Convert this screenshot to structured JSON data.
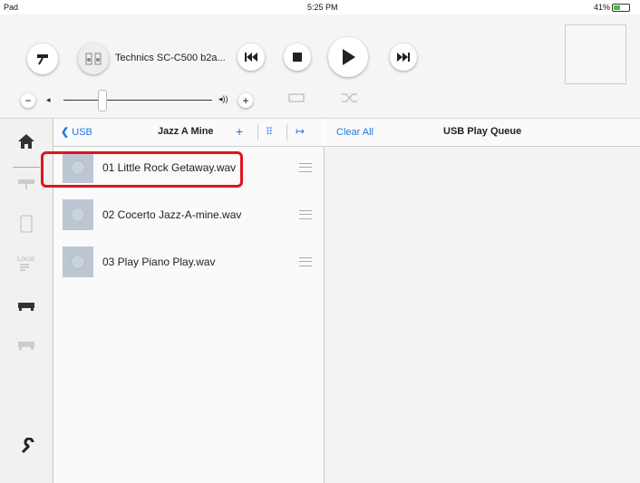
{
  "status_bar": {
    "left": "Pad",
    "time": "5:25 PM",
    "battery": "41%"
  },
  "player": {
    "device_name": "Technics SC-C500 b2a..."
  },
  "list": {
    "back_label": "USB",
    "title": "Jazz A Mine",
    "tracks": [
      {
        "name": "01 Little Rock Getaway.wav"
      },
      {
        "name": "02 Cocerto Jazz-A-mine.wav"
      },
      {
        "name": "03 Play Piano Play.wav"
      }
    ]
  },
  "queue": {
    "clear_label": "Clear All",
    "title": "USB Play Queue"
  },
  "colors": {
    "accent": "#1f77e6",
    "highlight": "#e0141f"
  }
}
